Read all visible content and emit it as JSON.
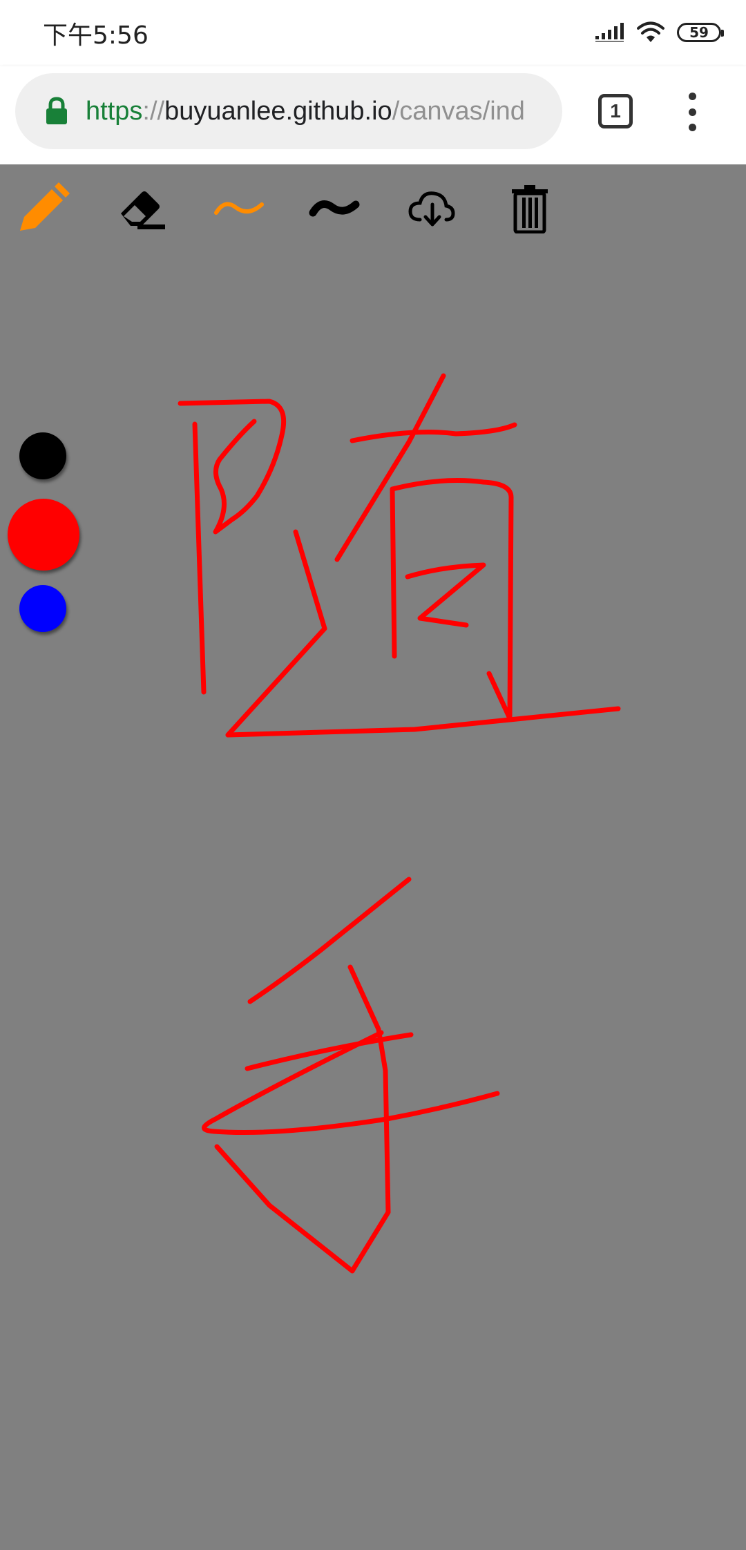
{
  "status_bar": {
    "time": "下午5:56",
    "battery": "59",
    "icons": [
      "signal-icon",
      "wifi-icon",
      "battery-icon"
    ]
  },
  "browser": {
    "url_scheme": "https",
    "url_separator": "://",
    "url_host": "buyuanlee.github.io",
    "url_path": "/canvas/ind",
    "tab_count": "1",
    "icons": [
      "lock-icon",
      "tabs-icon",
      "more-vert-icon"
    ]
  },
  "toolbar": {
    "tools": [
      {
        "name": "pen",
        "icon": "pencil-icon",
        "active": true
      },
      {
        "name": "eraser",
        "icon": "eraser-icon",
        "active": false
      },
      {
        "name": "thin",
        "icon": "thin-line-icon",
        "active": true
      },
      {
        "name": "thick",
        "icon": "thick-line-icon",
        "active": false
      },
      {
        "name": "download",
        "icon": "cloud-download-icon",
        "active": false
      },
      {
        "name": "clear",
        "icon": "trash-icon",
        "active": false
      }
    ],
    "active_color": "#ff8c00",
    "inactive_color": "#000000"
  },
  "palette": {
    "colors": [
      {
        "name": "black",
        "hex": "#000000",
        "selected": false
      },
      {
        "name": "red",
        "hex": "#ff0000",
        "selected": true
      },
      {
        "name": "blue",
        "hex": "#0000ff",
        "selected": false
      }
    ]
  },
  "canvas": {
    "background": "#808080",
    "stroke_color": "#ff0000",
    "content": "handwritten strokes"
  }
}
